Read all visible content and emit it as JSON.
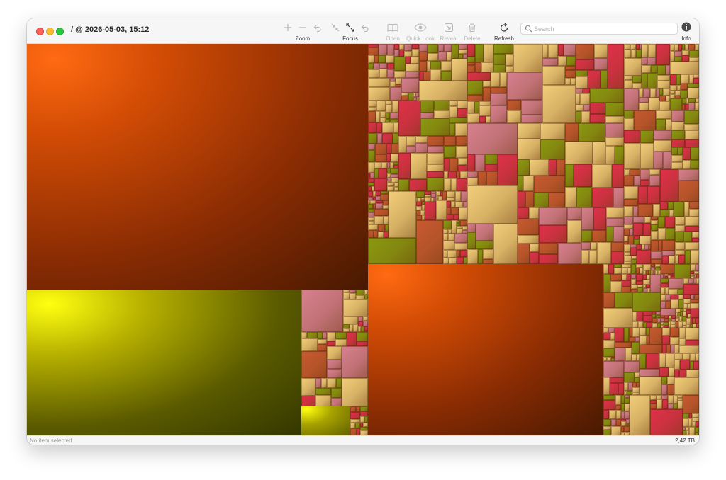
{
  "window": {
    "title": "/ @ 2026-05-03, 15:12"
  },
  "toolbar": {
    "zoom_label": "Zoom",
    "focus_label": "Focus",
    "open_label": "Open",
    "quicklook_label": "Quick Look",
    "reveal_label": "Reveal",
    "delete_label": "Delete",
    "refresh_label": "Refresh",
    "info_label": "Info",
    "icons": [
      "zoom-in-icon",
      "zoom-out-icon",
      "zoom-back-icon",
      "focus-in-icon",
      "focus-out-icon",
      "focus-back-icon",
      "book-icon",
      "eye-icon",
      "reveal-icon",
      "trash-icon",
      "refresh-icon",
      "info-icon"
    ]
  },
  "search": {
    "placeholder": "Search",
    "value": ""
  },
  "status": {
    "selection": "No item selected",
    "total_size": "2,42 TB"
  },
  "colors": {
    "orange": "#ff5a00",
    "yellow": "#ffff00",
    "tan": "#f2cf7a",
    "red": "#e0304a",
    "rust": "#c85a30",
    "olive": "#8a9a10",
    "pink": "#d88090"
  }
}
